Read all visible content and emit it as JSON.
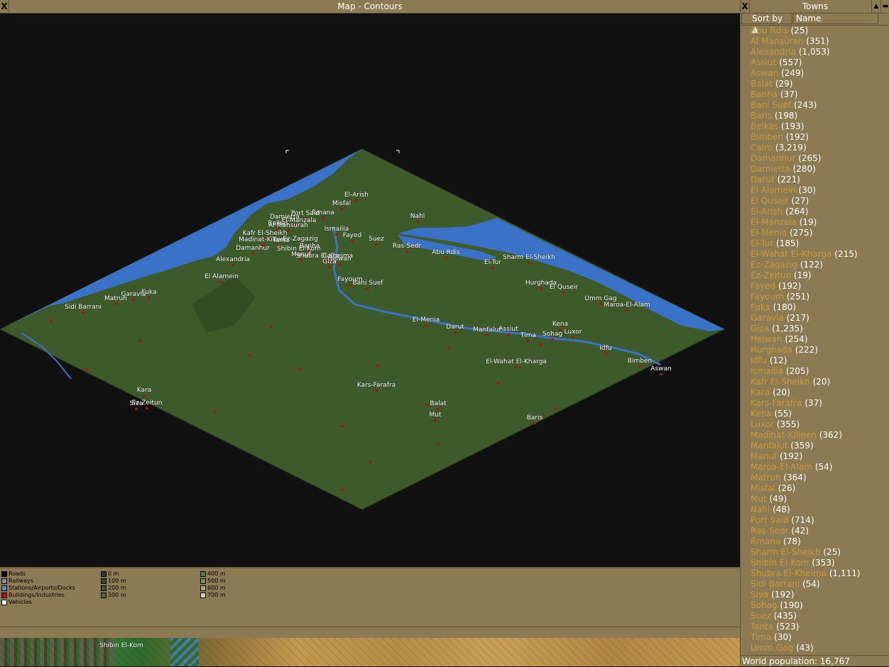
{
  "map_window": {
    "title": "Map - Contours",
    "close_glyph": "X",
    "towns": [
      "El-Arish",
      "Misfal",
      "Rmana",
      "Port Said",
      "Damietta",
      "El-Manzala",
      "Balkas",
      "Al Mansurah",
      "Nahl",
      "Ismailia",
      "Kafr El-Sheikh",
      "Madinat-Killeen",
      "Tanta",
      "Ez-Zagazig",
      "Fayed",
      "Suez",
      "Ras-Sedr",
      "Damanhur",
      "Shibin El-Kom",
      "Banha",
      "Manuf",
      "Shubra El-Kheima",
      "Helwan",
      "Cairo",
      "Giza",
      "Abu Rdis",
      "El-Tur",
      "Sharm El-Sheikh",
      "Alexandria",
      "El Alamein",
      "Fayoum",
      "Bani Suef",
      "Hurghada",
      "El Quseir",
      "Umm Gag",
      "Maroa-El-Alam",
      "Matruh",
      "Garavla",
      "Fuka",
      "Sidi Barrani",
      "El-Menia",
      "Darut",
      "Manfalut",
      "Assiut",
      "Kena",
      "Tima",
      "Sohag",
      "Luxor",
      "Idfu",
      "El-Wahat El-Kharga",
      "Bimben",
      "Aswan",
      "Kara",
      "Siva",
      "Ez-Zeitun",
      "Kars-Farafra",
      "Balat",
      "Mut",
      "Baris"
    ],
    "legend": {
      "categories": [
        {
          "label": "Roads",
          "color": "#000000"
        },
        {
          "label": "Railways",
          "color": "#8c8c9c"
        },
        {
          "label": "Stations/Airports/Docks",
          "color": "#4a90d8"
        },
        {
          "label": "Buildings/Industries",
          "color": "#b01010"
        },
        {
          "label": "Vehicles",
          "color": "#ffffff"
        }
      ],
      "heights": [
        {
          "label": "0 m",
          "color": "#243a18"
        },
        {
          "label": "100 m",
          "color": "#2e4a20"
        },
        {
          "label": "200 m",
          "color": "#3a5a2a"
        },
        {
          "label": "300 m",
          "color": "#4a6a34"
        },
        {
          "label": "400 m",
          "color": "#5c7a40"
        },
        {
          "label": "500 m",
          "color": "#7a9050"
        },
        {
          "label": "600 m",
          "color": "#a0b068"
        },
        {
          "label": "700 m",
          "color": "#d0d4a0"
        }
      ]
    }
  },
  "game_view": {
    "visible_town_label": "Shibin El-Kom"
  },
  "towns_window": {
    "title": "Towns",
    "close_glyph": "X",
    "sort_by_label": "Sort by ▲",
    "sort_criteria": "Name",
    "dropdown_glyph": "▼",
    "towns": [
      {
        "name": "Abu Rdis",
        "population": "(25)"
      },
      {
        "name": "Al Manşūrah",
        "population": "(351)"
      },
      {
        "name": "Alexandria",
        "population": "(1,053)"
      },
      {
        "name": "Assiut",
        "population": "(557)"
      },
      {
        "name": "Aswan",
        "population": "(249)"
      },
      {
        "name": "Balat",
        "population": "(29)"
      },
      {
        "name": "Banha",
        "population": "(37)"
      },
      {
        "name": "Bani Suef",
        "population": "(243)"
      },
      {
        "name": "Baris",
        "population": "(198)"
      },
      {
        "name": "Belkas",
        "population": "(193)"
      },
      {
        "name": "Bimben",
        "population": "(192)"
      },
      {
        "name": "Cairo",
        "population": "(3,219)"
      },
      {
        "name": "Damanhur",
        "population": "(265)"
      },
      {
        "name": "Damietta",
        "population": "(280)"
      },
      {
        "name": "Darut",
        "population": "(221)"
      },
      {
        "name": "El Alamein",
        "population": "(30)"
      },
      {
        "name": "El Quseir",
        "population": "(27)"
      },
      {
        "name": "El-Arish",
        "population": "(264)"
      },
      {
        "name": "El-Manzala",
        "population": "(19)"
      },
      {
        "name": "El-Menia",
        "population": "(275)"
      },
      {
        "name": "El-Tur",
        "population": "(185)"
      },
      {
        "name": "El-Wahat El-Kharga",
        "population": "(215)"
      },
      {
        "name": "Ez-Zagazig",
        "population": "(122)"
      },
      {
        "name": "Ez-Zeitun",
        "population": "(19)"
      },
      {
        "name": "Fayed",
        "population": "(192)"
      },
      {
        "name": "Fayoum",
        "population": "(251)"
      },
      {
        "name": "Fuka",
        "population": "(180)"
      },
      {
        "name": "Garavla",
        "population": "(217)"
      },
      {
        "name": "Giza",
        "population": "(1,235)"
      },
      {
        "name": "Helwan",
        "population": "(254)"
      },
      {
        "name": "Hurghada",
        "population": "(222)"
      },
      {
        "name": "Idfu",
        "population": "(12)"
      },
      {
        "name": "Ismailia",
        "population": "(205)"
      },
      {
        "name": "Kafr El-Sheikh",
        "population": "(20)"
      },
      {
        "name": "Kara",
        "population": "(20)"
      },
      {
        "name": "Kars-Farafra",
        "population": "(37)"
      },
      {
        "name": "Kena",
        "population": "(55)"
      },
      {
        "name": "Luxor",
        "population": "(355)"
      },
      {
        "name": "Madinat-Killeen",
        "population": "(362)"
      },
      {
        "name": "Manfalut",
        "population": "(359)"
      },
      {
        "name": "Manuf",
        "population": "(192)"
      },
      {
        "name": "Maroa-El-Alam",
        "population": "(54)"
      },
      {
        "name": "Matruh",
        "population": "(364)"
      },
      {
        "name": "Misfal",
        "population": "(26)"
      },
      {
        "name": "Mut",
        "population": "(49)"
      },
      {
        "name": "Nahl",
        "population": "(48)"
      },
      {
        "name": "Port Said",
        "population": "(714)"
      },
      {
        "name": "Ras-Sedr",
        "population": "(42)"
      },
      {
        "name": "Rmana",
        "population": "(78)"
      },
      {
        "name": "Sharm El-Sheikh",
        "population": "(25)"
      },
      {
        "name": "Shibin El-Kom",
        "population": "(353)"
      },
      {
        "name": "Shubra El-Kheima",
        "population": "(1,111)"
      },
      {
        "name": "Sidi Barrani",
        "population": "(54)"
      },
      {
        "name": "Siva",
        "population": "(192)"
      },
      {
        "name": "Sohag",
        "population": "(190)"
      },
      {
        "name": "Suez",
        "population": "(435)"
      },
      {
        "name": "Tanta",
        "population": "(523)"
      },
      {
        "name": "Tima",
        "population": "(30)"
      },
      {
        "name": "Umm Gag",
        "population": "(43)"
      }
    ],
    "world_population": "World population: 16,767"
  },
  "colors": {
    "window_bg": "#8c7a52",
    "map_land": "#3d5a2a",
    "map_water": "#3a72c8",
    "town_name": "#c89a3e"
  }
}
